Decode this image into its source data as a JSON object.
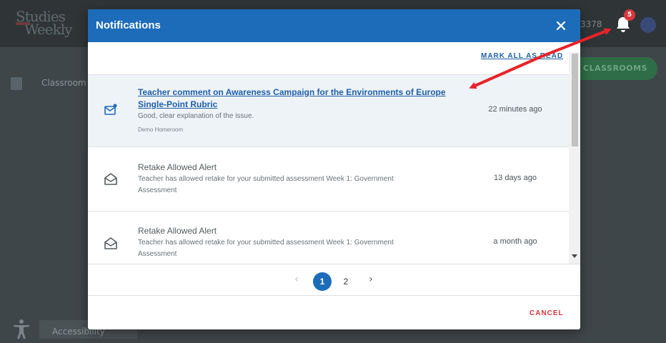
{
  "app": {
    "logo_line1": "Studies",
    "logo_line2": "Weekly",
    "header_id": "3378",
    "notification_count": "5",
    "sidebar_label": "Classroom",
    "add_classrooms_label": "D CLASSROOMS",
    "accessibility_label": "Accessibility"
  },
  "modal": {
    "title": "Notifications",
    "mark_all_label": "MARK ALL AS READ",
    "cancel_label": "CANCEL",
    "notifications": [
      {
        "title_line1": "Teacher comment on Awareness Campaign for the Environments of Europe",
        "title_line2": "Single-Point Rubric",
        "body": "Good, clear explanation of the issue.",
        "meta": "Demo Homeroom",
        "time": "22 minutes ago",
        "unread": true
      },
      {
        "title_line1": "Retake Allowed Alert",
        "body_line1": "Teacher has allowed retake for your submitted assessment Week 1: Government",
        "body_line2": "Assessment",
        "time": "13 days ago",
        "unread": false
      },
      {
        "title_line1": "Retake Allowed Alert",
        "body_line1": "Teacher has allowed retake for your submitted assessment Week 1: Government",
        "body_line2": "Assessment",
        "time": "a month ago",
        "unread": false
      }
    ],
    "pagination": {
      "prev": "‹",
      "pages": [
        "1",
        "2"
      ],
      "current": "1",
      "next": "›"
    }
  },
  "colors": {
    "accent": "#1d6cba",
    "badge": "#d9363e",
    "annotation": "#e8232a"
  },
  "icons": {
    "close": "close-icon",
    "bell": "bell-icon",
    "unread_mail": "mail-unread-icon",
    "read_mail": "envelope-open-icon"
  }
}
